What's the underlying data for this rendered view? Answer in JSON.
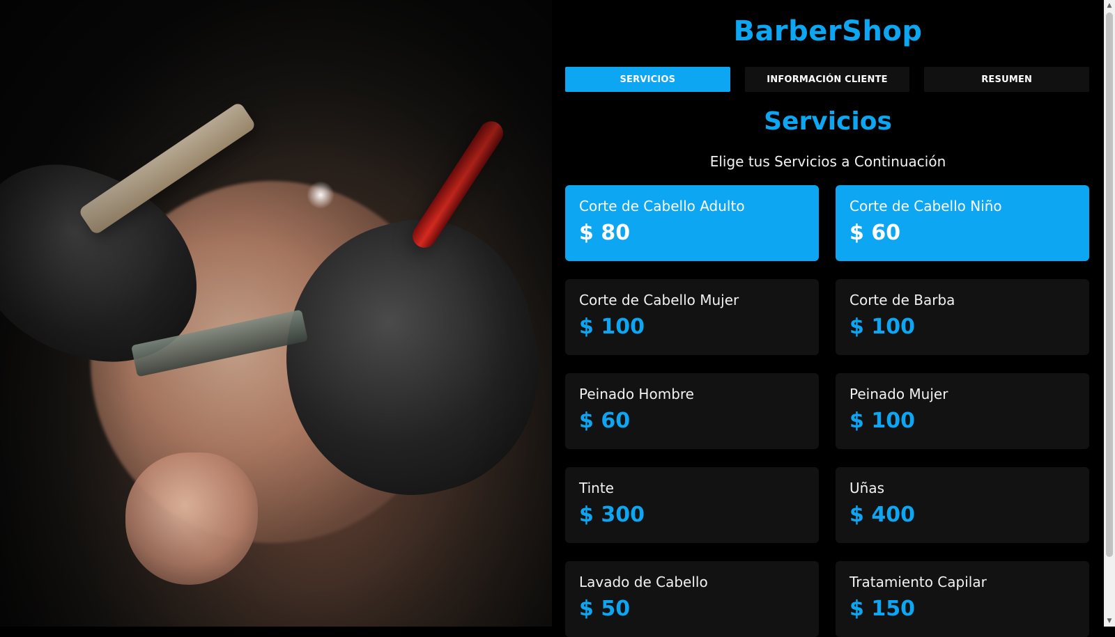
{
  "brand": {
    "title": "BarberShop"
  },
  "tabs": [
    {
      "label": "SERVICIOS",
      "active": true
    },
    {
      "label": "INFORMACIÓN CLIENTE",
      "active": false
    },
    {
      "label": "RESUMEN",
      "active": false
    }
  ],
  "section": {
    "title": "Servicios",
    "subtitle": "Elige tus Servicios a Continuación"
  },
  "services": [
    {
      "name": "Corte de Cabello Adulto",
      "price": "$ 80",
      "selected": true
    },
    {
      "name": "Corte de Cabello Niño",
      "price": "$ 60",
      "selected": true
    },
    {
      "name": "Corte de Cabello Mujer",
      "price": "$ 100",
      "selected": false
    },
    {
      "name": "Corte de Barba",
      "price": "$ 100",
      "selected": false
    },
    {
      "name": "Peinado Hombre",
      "price": "$ 60",
      "selected": false
    },
    {
      "name": "Peinado Mujer",
      "price": "$ 100",
      "selected": false
    },
    {
      "name": "Tinte",
      "price": "$ 300",
      "selected": false
    },
    {
      "name": "Uñas",
      "price": "$ 400",
      "selected": false
    },
    {
      "name": "Lavado de Cabello",
      "price": "$ 50",
      "selected": false
    },
    {
      "name": "Tratamiento Capilar",
      "price": "$ 150",
      "selected": false
    }
  ],
  "icons": {
    "scroll_up": "scroll-up-arrow-icon",
    "scroll_down": "scroll-down-arrow-icon"
  },
  "colors": {
    "accent": "#0da6f2",
    "panel_background": "#000000",
    "card_background": "#121212",
    "text_primary": "#f2f2f2"
  }
}
